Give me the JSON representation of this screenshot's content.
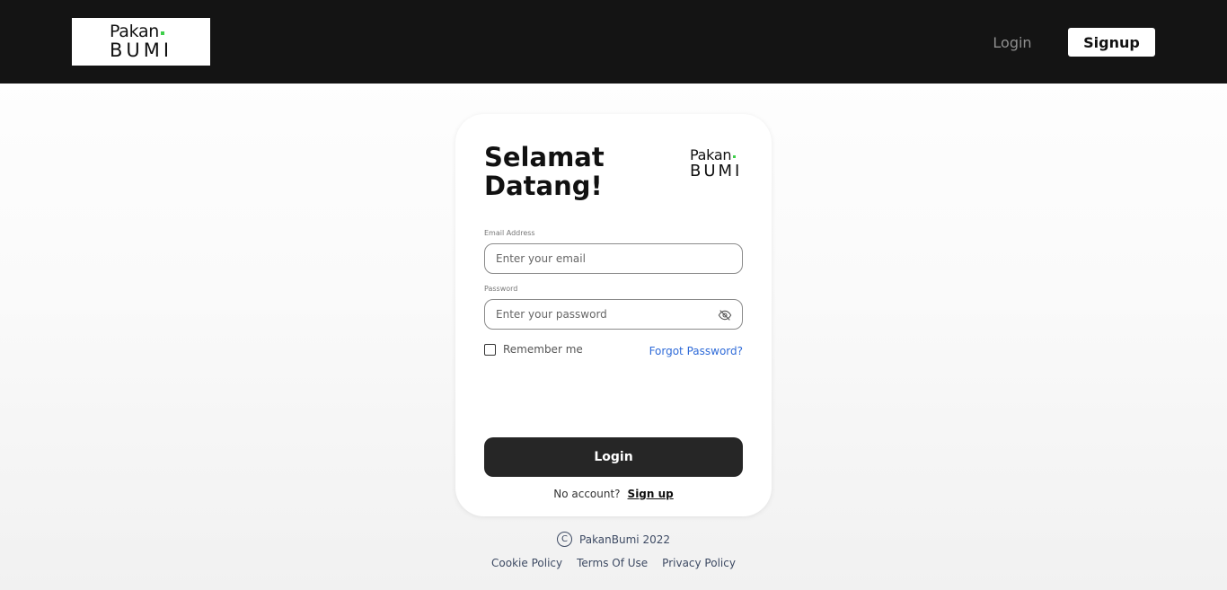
{
  "header": {
    "logo_line1": "Pakan",
    "logo_line2": "BUMI",
    "login_label": "Login",
    "signup_label": "Signup"
  },
  "card": {
    "logo_line1": "Pakan",
    "logo_line2": "BUMI",
    "title": "Selamat Datang!",
    "email_label": "Email Address",
    "email_placeholder": "Enter your email",
    "password_label": "Password",
    "password_placeholder": "Enter your password",
    "remember_label": "Remember me",
    "forgot_label": "Forgot Password?",
    "login_button": "Login",
    "no_account_text": "No account?",
    "signup_link": "Sign up"
  },
  "footer": {
    "copyright": "PakanBumi 2022",
    "links": [
      "Cookie Policy",
      "Terms Of Use",
      "Privacy Policy"
    ]
  },
  "colors": {
    "header_bg": "#141414",
    "button_dark": "#262626",
    "link_blue": "#2f6bd8",
    "logo_dot": "#3ecf4a"
  },
  "icons": {
    "password_toggle": "eye-slash-icon",
    "copyright": "copyright-icon"
  }
}
